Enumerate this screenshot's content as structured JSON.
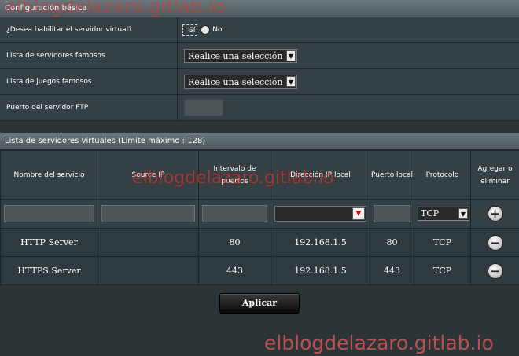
{
  "basic_config": {
    "header": "Configuración básica",
    "enable_label": "¿Desea habilitar el servidor virtual?",
    "yes_label": "Sí",
    "no_label": "No",
    "selected": "yes",
    "famous_servers_label": "Lista de servidores famosos",
    "famous_servers_value": "Realice una selección",
    "famous_games_label": "Lista de juegos famosos",
    "famous_games_value": "Realice una selección",
    "ftp_port_label": "Puerto del servidor FTP"
  },
  "virtual_servers": {
    "header": "Lista de servidores virtuales (Límite máximo : 128)",
    "columns": {
      "service_name": "Nombre del servicio",
      "source_ip": "Source IP",
      "port_range": "Intervalo de puertos",
      "local_ip": "Dirección IP local",
      "local_port": "Puerto local",
      "protocol": "Protocolo",
      "add_remove": "Agregar o eliminar"
    },
    "new_entry": {
      "protocol": "TCP"
    },
    "rows": [
      {
        "service_name": "HTTP Server",
        "source_ip": "",
        "port_range": "80",
        "local_ip": "192.168.1.5",
        "local_port": "80",
        "protocol": "TCP"
      },
      {
        "service_name": "HTTPS Server",
        "source_ip": "",
        "port_range": "443",
        "local_ip": "192.168.1.5",
        "local_port": "443",
        "protocol": "TCP"
      }
    ]
  },
  "apply_label": "Aplicar",
  "watermark_text": "elblogdelazaro.gitlab.io"
}
